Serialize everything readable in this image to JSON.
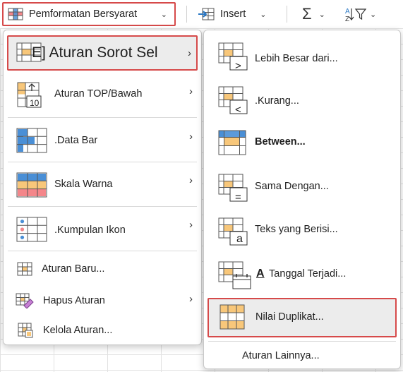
{
  "ribbon": {
    "conditional_formatting": "Pemformatan Bersyarat",
    "insert": "Insert"
  },
  "main_menu": {
    "items": [
      {
        "label": "E] Aturan Sorot Sel"
      },
      {
        "label": "Aturan TOP/Bawah"
      },
      {
        "label": ".Data   Bar"
      },
      {
        "label": "Skala Warna"
      },
      {
        "label": ".Kumpulan Ikon"
      },
      {
        "label": "Aturan Baru..."
      },
      {
        "label": "Hapus Aturan"
      },
      {
        "label": "Kelola Aturan..."
      }
    ],
    "top10_badge": "10"
  },
  "sub_menu": {
    "items": [
      {
        "label": "Lebih Besar dari..."
      },
      {
        "label": ".Kurang..."
      },
      {
        "label": "Between..."
      },
      {
        "label": "Sama Dengan..."
      },
      {
        "label": "Teks yang Berisi..."
      },
      {
        "label": "Tanggal Terjadi..."
      },
      {
        "label": "Nilai Duplikat..."
      },
      {
        "label": "Aturan Lainnya..."
      }
    ],
    "glyphs": {
      "greater": ">",
      "less": "<",
      "equal": "=",
      "text": "a",
      "date_letter": "A"
    }
  },
  "colors": {
    "highlight_border": "#d64a4a",
    "orange_fill": "#f8c77a",
    "blue_fill": "#4a8fd6",
    "red_fill": "#f4868a"
  }
}
